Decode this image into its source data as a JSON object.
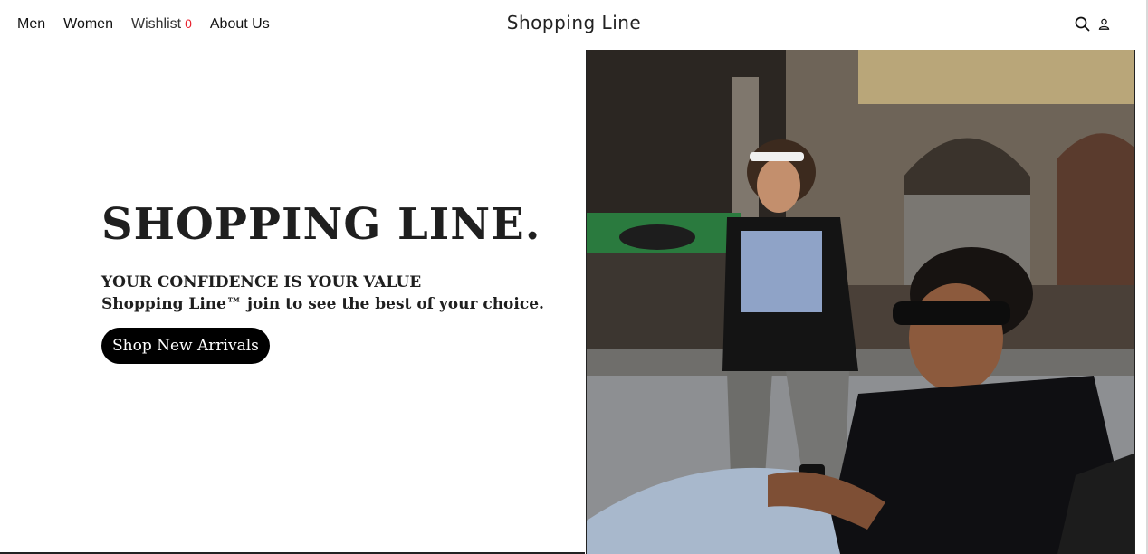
{
  "nav": {
    "items": [
      "Men",
      "Women",
      "Wishlist",
      "About Us"
    ],
    "wishlist_count": "0"
  },
  "brand": "Shopping Line",
  "icons": [
    "search-icon",
    "user-icon"
  ],
  "hero": {
    "title": "SHOPPING LINE.",
    "tagline_line1": "YOUR CONFIDENCE IS YOUR VALUE",
    "tagline_line2": "Shopping Line™ join to see the best of your choice.",
    "cta_label": "Shop New Arrivals"
  },
  "colors": {
    "accent_badge": "#e8212e",
    "cta_bg": "#000000",
    "text": "#1f1f1f"
  }
}
